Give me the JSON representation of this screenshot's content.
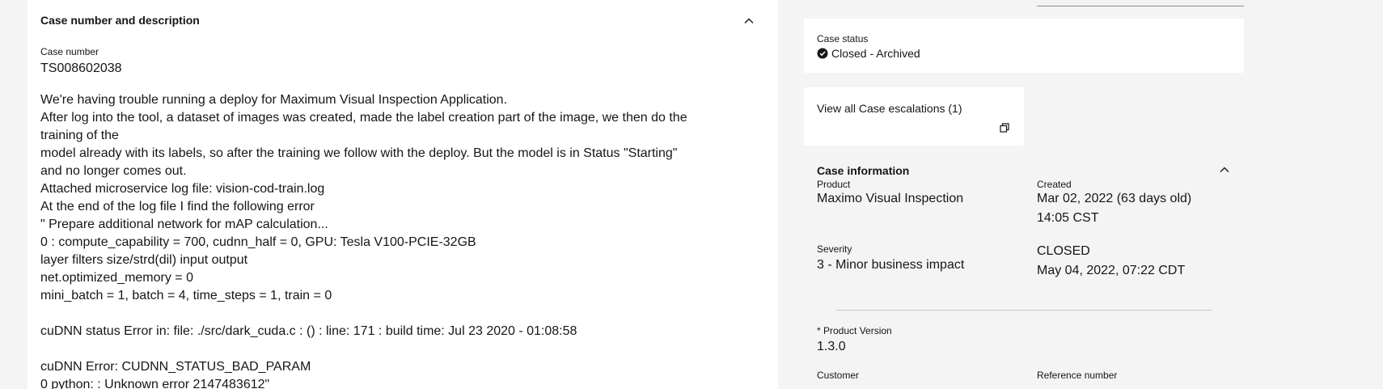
{
  "left": {
    "section_title": "Case number and description",
    "case_number_label": "Case number",
    "case_number": "TS008602038",
    "description_lines": [
      "We're having trouble running a deploy for Maximum Visual Inspection Application.",
      "After log into the tool, a dataset of images was created, made the label creation part of the image, we then do the training of the",
      "model already with its labels, so after the training we follow with the deploy. But the model is in Status \"Starting\" and no longer comes out.",
      "Attached microservice log file: vision-cod-train.log",
      "At the end of the log file I find the following error",
      "\" Prepare additional network for mAP calculation...",
      "0 : compute_capability = 700, cudnn_half = 0, GPU: Tesla V100-PCIE-32GB",
      "layer filters size/strd(dil) input output",
      "net.optimized_memory = 0",
      "mini_batch = 1, batch = 4, time_steps = 1, train = 0",
      "",
      "cuDNN status Error in: file: ./src/dark_cuda.c : () : line: 171 : build time: Jul 23 2020 - 01:08:58",
      "",
      "cuDNN Error: CUDNN_STATUS_BAD_PARAM",
      "0 python: : Unknown error 2147483612\""
    ]
  },
  "status": {
    "label": "Case status",
    "value": "Closed - Archived",
    "icon": "checkmark-filled-icon"
  },
  "escalation": {
    "link": "View all Case escalations (1)",
    "icon": "launch-icon"
  },
  "info": {
    "title": "Case information",
    "product_label": "Product",
    "product_value": "Maximo Visual Inspection",
    "created_label": "Created",
    "created_date": "Mar 02, 2022 (63 days old)",
    "created_time": "14:05 CST",
    "severity_label": "Severity",
    "severity_value": "3 - Minor business impact",
    "closed_status": "CLOSED",
    "closed_date": "May 04, 2022, 07:22 CDT",
    "version_label": "* Product Version",
    "version_value": "1.3.0",
    "customer_label": "Customer",
    "reference_label": "Reference number"
  }
}
